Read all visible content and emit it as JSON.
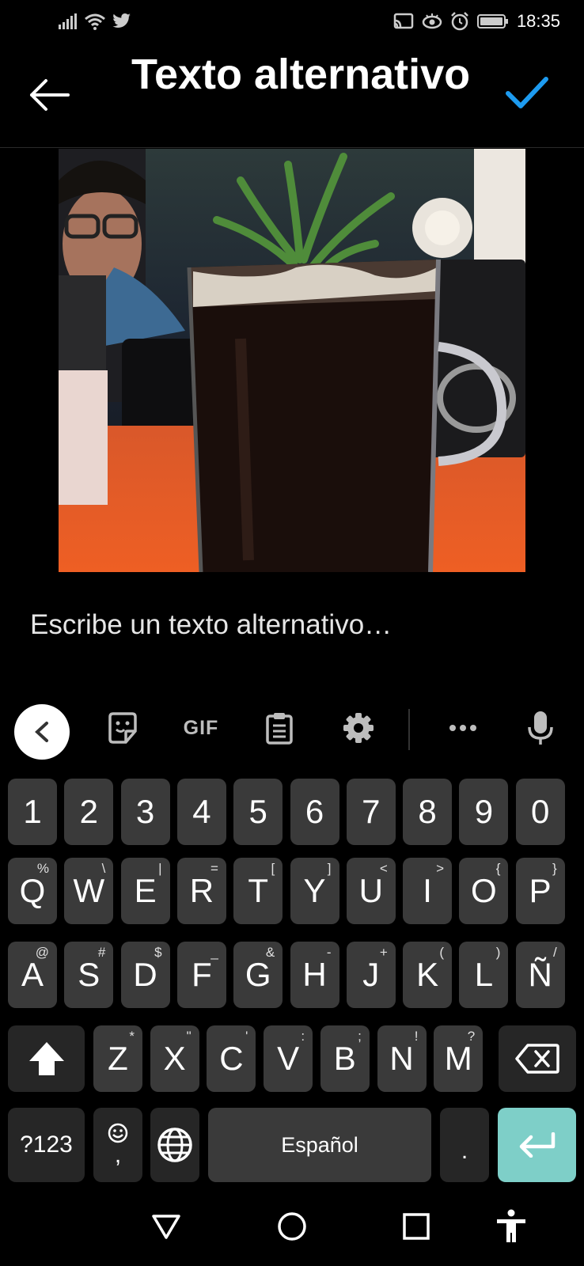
{
  "status_bar": {
    "time": "18:35",
    "left_icons": [
      "signal-icon",
      "wifi-icon",
      "twitter-icon"
    ],
    "right_icons": [
      "cast-icon",
      "eye-icon",
      "alarm-icon",
      "battery-icon"
    ]
  },
  "header": {
    "title": "Texto alternativo",
    "back_icon": "arrow-left-icon",
    "confirm_icon": "check-icon",
    "accent_color": "#1d9bf0"
  },
  "alt_text": {
    "placeholder": "Escribe un texto alternativo…",
    "value": ""
  },
  "keyboard": {
    "toolbar": {
      "collapse_icon": "chevron-left-icon",
      "sticker_icon": "sticker-icon",
      "gif_label": "GIF",
      "clipboard_icon": "clipboard-icon",
      "settings_icon": "gear-icon",
      "more_icon": "more-icon",
      "mic_icon": "mic-icon"
    },
    "number_row": [
      "1",
      "2",
      "3",
      "4",
      "5",
      "6",
      "7",
      "8",
      "9",
      "0"
    ],
    "row1": [
      {
        "key": "Q",
        "hint": "%"
      },
      {
        "key": "W",
        "hint": "\\"
      },
      {
        "key": "E",
        "hint": "|"
      },
      {
        "key": "R",
        "hint": "="
      },
      {
        "key": "T",
        "hint": "["
      },
      {
        "key": "Y",
        "hint": "]"
      },
      {
        "key": "U",
        "hint": "<"
      },
      {
        "key": "I",
        "hint": ">"
      },
      {
        "key": "O",
        "hint": "{"
      },
      {
        "key": "P",
        "hint": "}"
      }
    ],
    "row2": [
      {
        "key": "A",
        "hint": "@"
      },
      {
        "key": "S",
        "hint": "#"
      },
      {
        "key": "D",
        "hint": "$"
      },
      {
        "key": "F",
        "hint": "_"
      },
      {
        "key": "G",
        "hint": "&"
      },
      {
        "key": "H",
        "hint": "-"
      },
      {
        "key": "J",
        "hint": "+"
      },
      {
        "key": "K",
        "hint": "("
      },
      {
        "key": "L",
        "hint": ")"
      },
      {
        "key": "Ñ",
        "hint": "/"
      }
    ],
    "row3": [
      {
        "key": "Z",
        "hint": "*"
      },
      {
        "key": "X",
        "hint": "\""
      },
      {
        "key": "C",
        "hint": "'"
      },
      {
        "key": "V",
        "hint": ":"
      },
      {
        "key": "B",
        "hint": ";"
      },
      {
        "key": "N",
        "hint": "!"
      },
      {
        "key": "M",
        "hint": "?"
      }
    ],
    "shift_icon": "shift-icon",
    "backspace_icon": "backspace-icon",
    "symbols_label": "?123",
    "emoji_comma": {
      "label": ",",
      "icon": "emoji-icon"
    },
    "globe_icon": "globe-icon",
    "space_label": "Español",
    "period_label": ".",
    "enter_icon": "enter-icon",
    "enter_color": "#7ecfc8"
  },
  "nav_bar": {
    "back_icon": "triangle-back-icon",
    "home_icon": "circle-home-icon",
    "recents_icon": "square-recents-icon",
    "accessibility_icon": "accessibility-icon"
  }
}
